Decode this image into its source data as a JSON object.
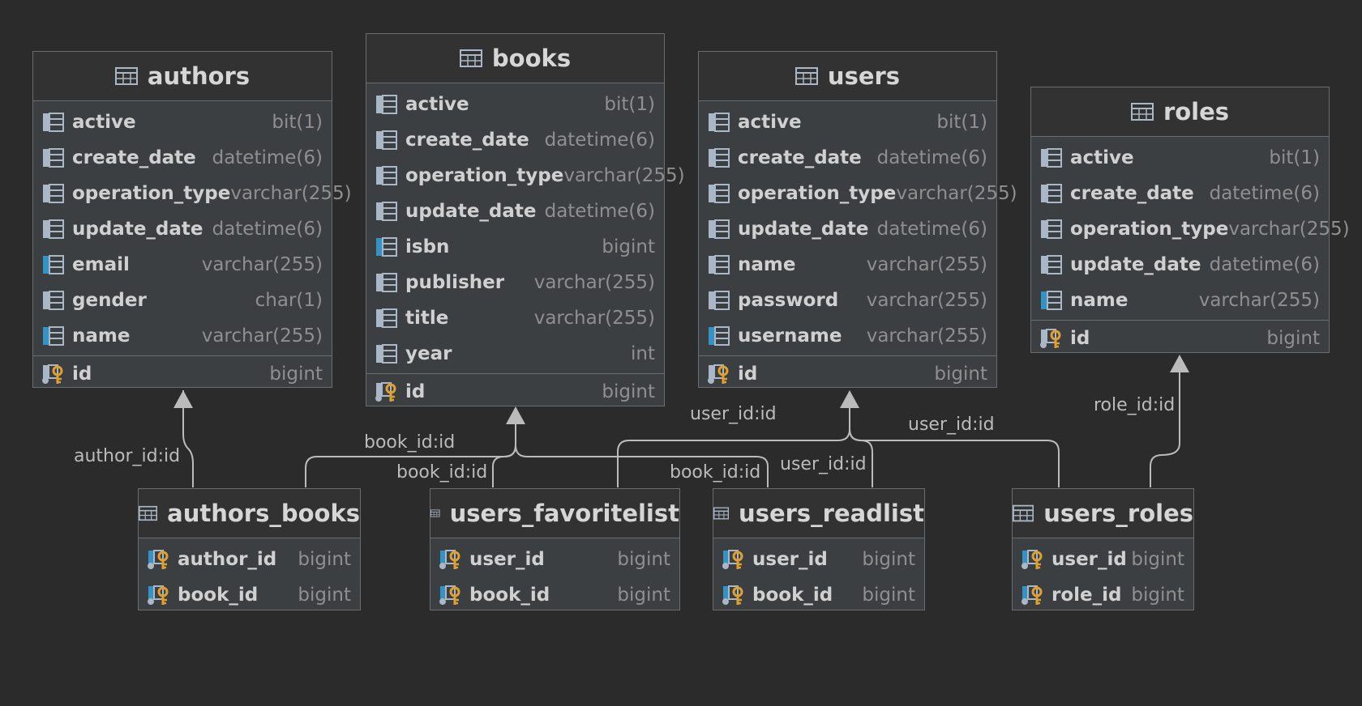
{
  "entities": {
    "authors": {
      "title": "authors",
      "columns": [
        {
          "name": "active",
          "type": "bit(1)",
          "icon": "column-icon"
        },
        {
          "name": "create_date",
          "type": "datetime(6)",
          "icon": "column-icon"
        },
        {
          "name": "operation_type",
          "type": "varchar(255)",
          "icon": "column-icon"
        },
        {
          "name": "update_date",
          "type": "datetime(6)",
          "icon": "column-icon"
        },
        {
          "name": "email",
          "type": "varchar(255)",
          "icon": "indexed-column-icon"
        },
        {
          "name": "gender",
          "type": "char(1)",
          "icon": "column-icon"
        },
        {
          "name": "name",
          "type": "varchar(255)",
          "icon": "indexed-column-icon"
        }
      ],
      "keys": [
        {
          "name": "id",
          "type": "bigint",
          "icon": "primary-key-icon"
        }
      ]
    },
    "books": {
      "title": "books",
      "columns": [
        {
          "name": "active",
          "type": "bit(1)",
          "icon": "column-icon"
        },
        {
          "name": "create_date",
          "type": "datetime(6)",
          "icon": "column-icon"
        },
        {
          "name": "operation_type",
          "type": "varchar(255)",
          "icon": "column-icon"
        },
        {
          "name": "update_date",
          "type": "datetime(6)",
          "icon": "column-icon"
        },
        {
          "name": "isbn",
          "type": "bigint",
          "icon": "indexed-column-icon"
        },
        {
          "name": "publisher",
          "type": "varchar(255)",
          "icon": "column-icon"
        },
        {
          "name": "title",
          "type": "varchar(255)",
          "icon": "column-icon"
        },
        {
          "name": "year",
          "type": "int",
          "icon": "column-icon"
        }
      ],
      "keys": [
        {
          "name": "id",
          "type": "bigint",
          "icon": "primary-key-icon"
        }
      ]
    },
    "users": {
      "title": "users",
      "columns": [
        {
          "name": "active",
          "type": "bit(1)",
          "icon": "column-icon"
        },
        {
          "name": "create_date",
          "type": "datetime(6)",
          "icon": "column-icon"
        },
        {
          "name": "operation_type",
          "type": "varchar(255)",
          "icon": "column-icon"
        },
        {
          "name": "update_date",
          "type": "datetime(6)",
          "icon": "column-icon"
        },
        {
          "name": "name",
          "type": "varchar(255)",
          "icon": "column-icon"
        },
        {
          "name": "password",
          "type": "varchar(255)",
          "icon": "column-icon"
        },
        {
          "name": "username",
          "type": "varchar(255)",
          "icon": "indexed-column-icon"
        }
      ],
      "keys": [
        {
          "name": "id",
          "type": "bigint",
          "icon": "primary-key-icon"
        }
      ]
    },
    "roles": {
      "title": "roles",
      "columns": [
        {
          "name": "active",
          "type": "bit(1)",
          "icon": "column-icon"
        },
        {
          "name": "create_date",
          "type": "datetime(6)",
          "icon": "column-icon"
        },
        {
          "name": "operation_type",
          "type": "varchar(255)",
          "icon": "column-icon"
        },
        {
          "name": "update_date",
          "type": "datetime(6)",
          "icon": "column-icon"
        },
        {
          "name": "name",
          "type": "varchar(255)",
          "icon": "indexed-column-icon"
        }
      ],
      "keys": [
        {
          "name": "id",
          "type": "bigint",
          "icon": "primary-key-icon"
        }
      ]
    },
    "authors_books": {
      "title": "authors_books",
      "columns": [],
      "keys": [
        {
          "name": "author_id",
          "type": "bigint",
          "icon": "foreign-primary-key-icon"
        },
        {
          "name": "book_id",
          "type": "bigint",
          "icon": "foreign-primary-key-icon"
        }
      ]
    },
    "users_favoritelist": {
      "title": "users_favoritelist",
      "columns": [],
      "keys": [
        {
          "name": "user_id",
          "type": "bigint",
          "icon": "foreign-primary-key-icon"
        },
        {
          "name": "book_id",
          "type": "bigint",
          "icon": "foreign-primary-key-icon"
        }
      ]
    },
    "users_readlist": {
      "title": "users_readlist",
      "columns": [],
      "keys": [
        {
          "name": "user_id",
          "type": "bigint",
          "icon": "foreign-primary-key-icon"
        },
        {
          "name": "book_id",
          "type": "bigint",
          "icon": "foreign-primary-key-icon"
        }
      ]
    },
    "users_roles": {
      "title": "users_roles",
      "columns": [],
      "keys": [
        {
          "name": "user_id",
          "type": "bigint",
          "icon": "foreign-primary-key-icon"
        },
        {
          "name": "role_id",
          "type": "bigint",
          "icon": "foreign-primary-key-icon"
        }
      ]
    }
  },
  "relations": [
    {
      "label": "author_id:id",
      "from": "authors_books",
      "to": "authors"
    },
    {
      "label": "book_id:id",
      "from": "authors_books",
      "to": "books"
    },
    {
      "label": "book_id:id",
      "from": "users_favoritelist",
      "to": "books"
    },
    {
      "label": "book_id:id",
      "from": "users_readlist",
      "to": "books"
    },
    {
      "label": "user_id:id",
      "from": "users_favoritelist",
      "to": "users"
    },
    {
      "label": "user_id:id",
      "from": "users_readlist",
      "to": "users"
    },
    {
      "label": "user_id:id",
      "from": "users_roles",
      "to": "users"
    },
    {
      "label": "role_id:id",
      "from": "users_roles",
      "to": "roles"
    }
  ],
  "colors": {
    "background": "#2b2b2b",
    "entity_body": "#3c3f41",
    "entity_header": "#323232",
    "border": "#6a6d70",
    "edge": "#bbbbbb",
    "column_icon": "#a9b7c6",
    "indexed_accent": "#3592c4",
    "key_gold": "#e0a030"
  }
}
